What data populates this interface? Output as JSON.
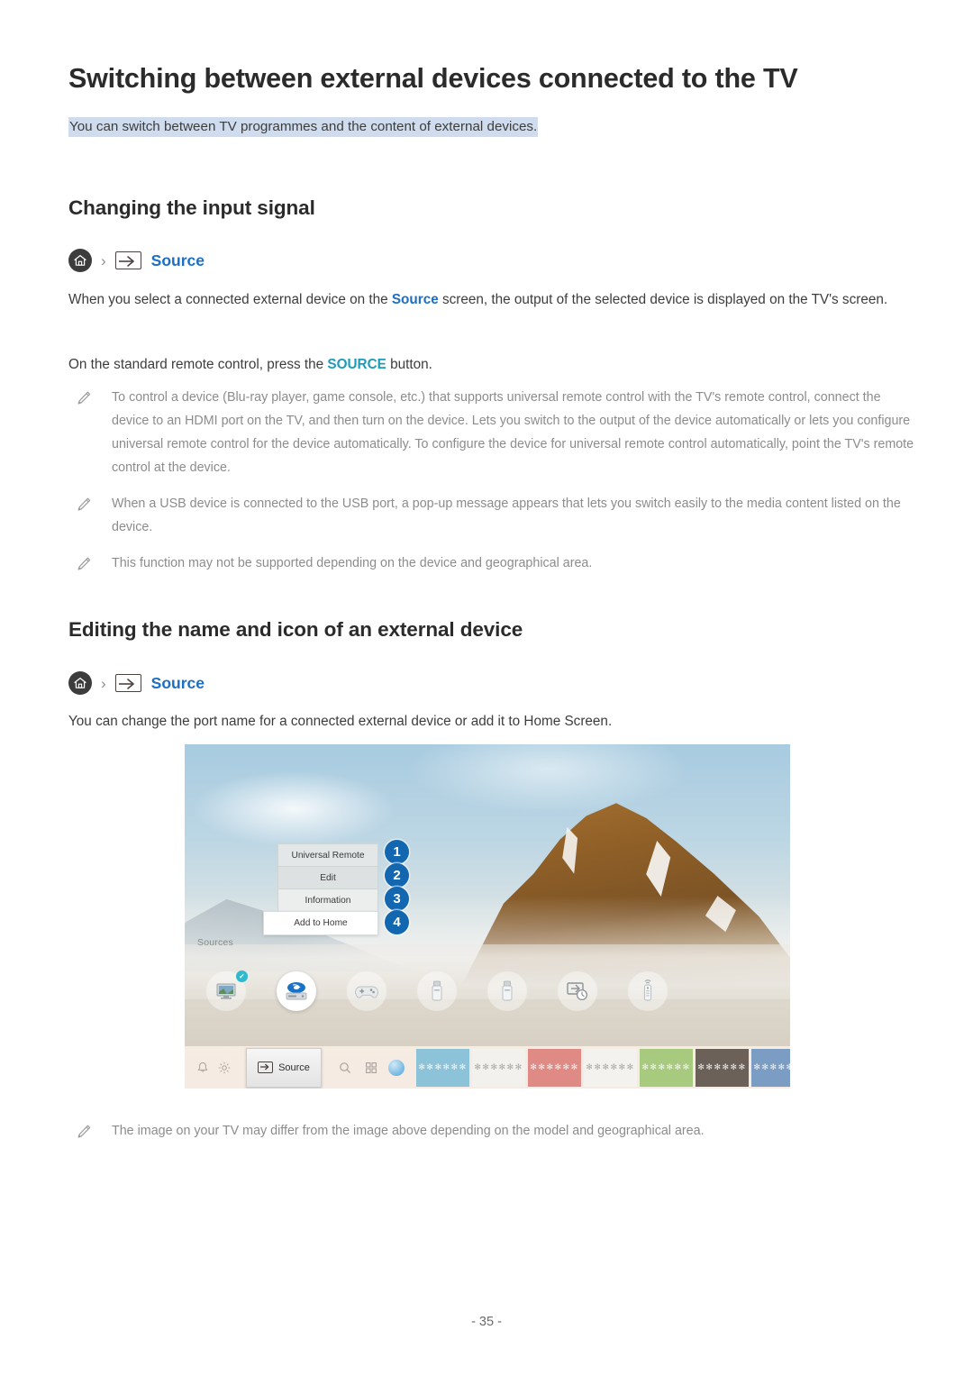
{
  "document": {
    "title": "Switching between external devices connected to the TV",
    "subtitle": "You can switch between TV programmes and the content of external devices.",
    "page_number": "- 35 -"
  },
  "section_input_signal": {
    "heading": "Changing the input signal",
    "breadcrumb": {
      "home_icon": "home-icon",
      "separator": "›",
      "source_icon": "source-input-icon",
      "label": "Source"
    },
    "paragraph_1_part_1": "When you select a connected external device on the ",
    "paragraph_1_link": "Source",
    "paragraph_1_part_2": " screen, the output of the selected device is displayed on the TV's screen.",
    "paragraph_2_part_1": "On the standard remote control, press the ",
    "paragraph_2_link": "SOURCE",
    "paragraph_2_part_2": " button.",
    "notes": [
      "To control a device (Blu-ray player, game console, etc.) that supports universal remote control with the TV's remote control, connect the device to an HDMI port on the TV, and then turn on the device. Lets you switch to the output of the device automatically or lets you configure universal remote control for the device automatically. To configure the device for universal remote control automatically, point the TV's remote control at the device.",
      "When a USB device is connected to the USB port, a pop-up message appears that lets you switch easily to the media content listed on the device.",
      "This function may not be supported depending on the device and geographical area."
    ]
  },
  "section_edit_device": {
    "heading": "Editing the name and icon of an external device",
    "breadcrumb": {
      "home_icon": "home-icon",
      "separator": "›",
      "source_icon": "source-input-icon",
      "label": "Source"
    },
    "paragraph": "You can change the port name for a connected external device or add it to Home Screen.",
    "note": "The image on your TV may differ from the image above depending on the model and geographical area."
  },
  "tv_screenshot": {
    "sources_label": "Sources",
    "context_menu": [
      {
        "label": "Universal Remote",
        "badge": "1"
      },
      {
        "label": "Edit",
        "badge": "2"
      },
      {
        "label": "Information",
        "badge": "3"
      },
      {
        "label": "Add to Home",
        "badge": "4"
      }
    ],
    "device_icons": [
      {
        "name": "tv-monitor-icon",
        "selected": false,
        "checked": true
      },
      {
        "name": "blu-ray-player-icon",
        "selected": true,
        "checked": false
      },
      {
        "name": "game-controller-icon",
        "selected": false,
        "checked": false
      },
      {
        "name": "usb-drive-icon",
        "selected": false,
        "checked": false
      },
      {
        "name": "usb-drive-icon",
        "selected": false,
        "checked": false
      },
      {
        "name": "input-connection-guide-icon",
        "selected": false,
        "checked": false
      },
      {
        "name": "remote-control-icon",
        "selected": false,
        "checked": false
      }
    ],
    "bottom_bar": {
      "notification_icon": "bell-icon",
      "settings_icon": "gear-icon",
      "source_button_label": "Source",
      "source_button_icon": "source-input-icon",
      "search_icon": "search-icon",
      "apps_icon": "apps-grid-icon",
      "featured_app_icon": "app-circle-icon",
      "app_tiles": [
        {
          "label": "✻✻✻✻✻✻",
          "color": "#8cc3d9",
          "light_text": false
        },
        {
          "label": "✻✻✻✻✻✻",
          "color": "#f2f1ee",
          "light_text": true
        },
        {
          "label": "✻✻✻✻✻✻",
          "color": "#e08a86",
          "light_text": false
        },
        {
          "label": "✻✻✻✻✻✻",
          "color": "#f3f2ef",
          "light_text": true
        },
        {
          "label": "✻✻✻✻✻✻",
          "color": "#a8ca7e",
          "light_text": false
        },
        {
          "label": "✻✻✻✻✻✻",
          "color": "#6b6159",
          "light_text": false
        },
        {
          "label": "✻✻✻✻✻✻",
          "color": "#7b9dc4",
          "light_text": false
        },
        {
          "label": "✻✻✻✻✻✻",
          "color": "#54b79b",
          "light_text": false
        }
      ]
    }
  },
  "colors": {
    "link_blue": "#1c6fc4",
    "link_teal": "#1b9cb8",
    "highlight": "#cfdcee",
    "badge_blue": "#1267b0",
    "note_gray": "#8c8c8c"
  }
}
